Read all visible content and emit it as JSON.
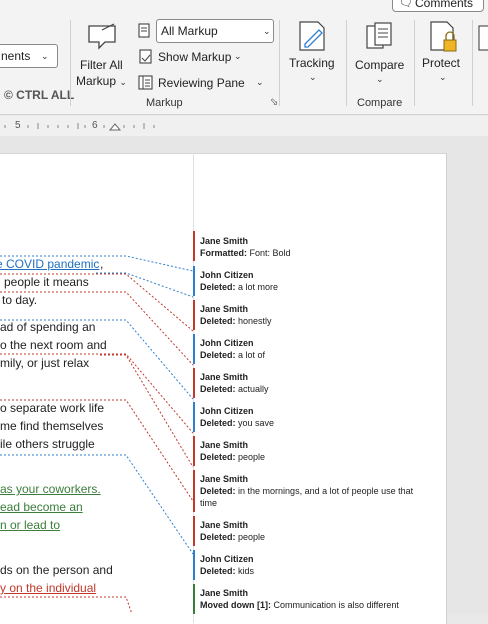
{
  "ribbon": {
    "comments_button": "Comments",
    "display_for_review_partial": "nents",
    "display_for_review_value": "All Markup",
    "filter_all_markup_line1": "Filter All",
    "filter_all_markup_line2": "Markup",
    "show_markup": "Show Markup",
    "reviewing_pane": "Reviewing Pane",
    "markup_group": "Markup",
    "tracking": "Tracking",
    "compare": "Compare",
    "compare_group": "Compare",
    "protect": "Protect",
    "watermark": "© CTRL ALL"
  },
  "ruler": {
    "mark5": "5",
    "mark6": "6"
  },
  "document": {
    "lines": [
      {
        "text": "e COVID pandemic",
        "style": "link-blue"
      },
      {
        "text": ",",
        "style": "plain"
      },
      {
        "text": "people it means",
        "style": "plain"
      },
      {
        "text": "to day.",
        "style": "plain"
      },
      {
        "text": "ad of spending an",
        "style": "plain"
      },
      {
        "text": "o the next room and",
        "style": "plain"
      },
      {
        "text": "mily, or just relax",
        "style": "plain"
      },
      {
        "text": "o separate work life",
        "style": "plain"
      },
      {
        "text": "me find themselves",
        "style": "plain"
      },
      {
        "text": "ile others struggle",
        "style": "plain"
      },
      {
        "text": "as your coworkers.",
        "style": "ins-green"
      },
      {
        "text": "ead become an",
        "style": "ins-green"
      },
      {
        "text": "n or lead to",
        "style": "ins-green"
      },
      {
        "text": "ds on the person and",
        "style": "plain"
      },
      {
        "text": "y on the individual",
        "style": "del-red"
      }
    ]
  },
  "balloons": [
    {
      "author": "Jane Smith",
      "kind": "Formatted:",
      "detail": "Font: Bold",
      "color": "#c0392b"
    },
    {
      "author": "John Citizen",
      "kind": "Deleted:",
      "detail": "a lot more",
      "color": "#2f7fd0"
    },
    {
      "author": "Jane Smith",
      "kind": "Deleted:",
      "detail": "honestly",
      "color": "#c0392b"
    },
    {
      "author": "John Citizen",
      "kind": "Deleted:",
      "detail": "a lot of",
      "color": "#2f7fd0"
    },
    {
      "author": "Jane Smith",
      "kind": "Deleted:",
      "detail": "actually",
      "color": "#c0392b"
    },
    {
      "author": "John Citizen",
      "kind": "Deleted:",
      "detail": "you save",
      "color": "#2f7fd0"
    },
    {
      "author": "Jane Smith",
      "kind": "Deleted:",
      "detail": "people",
      "color": "#c0392b"
    },
    {
      "author": "Jane Smith",
      "kind": "Deleted:",
      "detail": "in the mornings, and a lot of people use that time",
      "color": "#c0392b"
    },
    {
      "author": "Jane Smith",
      "kind": "Deleted:",
      "detail": "people",
      "color": "#c0392b"
    },
    {
      "author": "John Citizen",
      "kind": "Deleted:",
      "detail": "kids",
      "color": "#2f7fd0"
    },
    {
      "author": "Jane Smith",
      "kind": "Moved down [1]:",
      "detail": "Communication is also different",
      "color": "#3b7d3b"
    }
  ],
  "colors": {
    "jane": "#c0392b",
    "john": "#2f7fd0",
    "move": "#3b7d3b"
  }
}
